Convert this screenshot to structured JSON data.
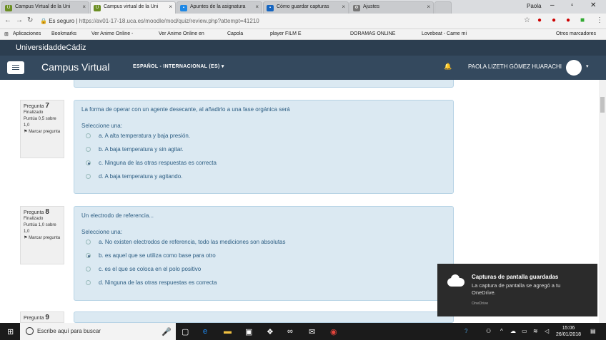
{
  "browser": {
    "tabs": [
      {
        "label": "Campus Virtual de la Uni"
      },
      {
        "label": "Campus virtual de la Uni"
      },
      {
        "label": "Apuntes de la asignatura"
      },
      {
        "label": "Cómo guardar capturas"
      },
      {
        "label": "Ajustes"
      }
    ],
    "window_user": "Paola",
    "secure_label": "Es seguro",
    "url": "https://av01-17-18.uca.es/moodle/mod/quiz/review.php?attempt=41210",
    "bookmarks": [
      "Aplicaciones",
      "Bookmarks",
      "Ver Anime Online -",
      "Ver Anime Online en",
      "Capola",
      "player FILM E",
      "DORAMAS ONLINE",
      "Lovebeat - Came mi",
      "Otros marcadores"
    ]
  },
  "site": {
    "university": "UniversidaddeCádiz",
    "brand": "Campus Virtual",
    "language": "ESPAÑOL - INTERNACIONAL (ES) ▾",
    "user": "PAOLA LIZETH GÓMEZ HUARACHI"
  },
  "questions": [
    {
      "label": "Pregunta",
      "number": "7",
      "status": "Finalizado",
      "score": "Puntúa 0,5 sobre 1,0",
      "flag": "Marcar pregunta",
      "text": "La forma de operar con un agente desecante, al añadirlo a una fase orgánica será",
      "prompt": "Seleccione una:",
      "options": [
        "a. A alta temperatura y baja presión.",
        "b. A baja temperatura y sin agitar.",
        "c. Ninguna de las otras respuestas es correcta",
        "d. A baja temperatura y agitando."
      ],
      "selected_index": 2
    },
    {
      "label": "Pregunta",
      "number": "8",
      "status": "Finalizado",
      "score": "Puntúa 1,0 sobre 1,0",
      "flag": "Marcar pregunta",
      "text": "Un electrodo de referencia...",
      "prompt": "Seleccione una:",
      "options": [
        "a. No existen electrodos de referencia, todo las mediciones son absolutas",
        "b. es aquel que se utiliza como base para otro",
        "c. es el que se coloca en el polo positivo",
        "d. Ninguna de las otras respuestas es correcta"
      ],
      "selected_index": 1
    },
    {
      "label": "Pregunta",
      "number": "9"
    }
  ],
  "toast": {
    "title": "Capturas de pantalla guardadas",
    "body": "La captura de pantalla se agregó a tu OneDrive.",
    "source": "OneDrive"
  },
  "taskbar": {
    "search_placeholder": "Escribe aquí para buscar",
    "time": "15:06",
    "date": "26/01/2018"
  }
}
